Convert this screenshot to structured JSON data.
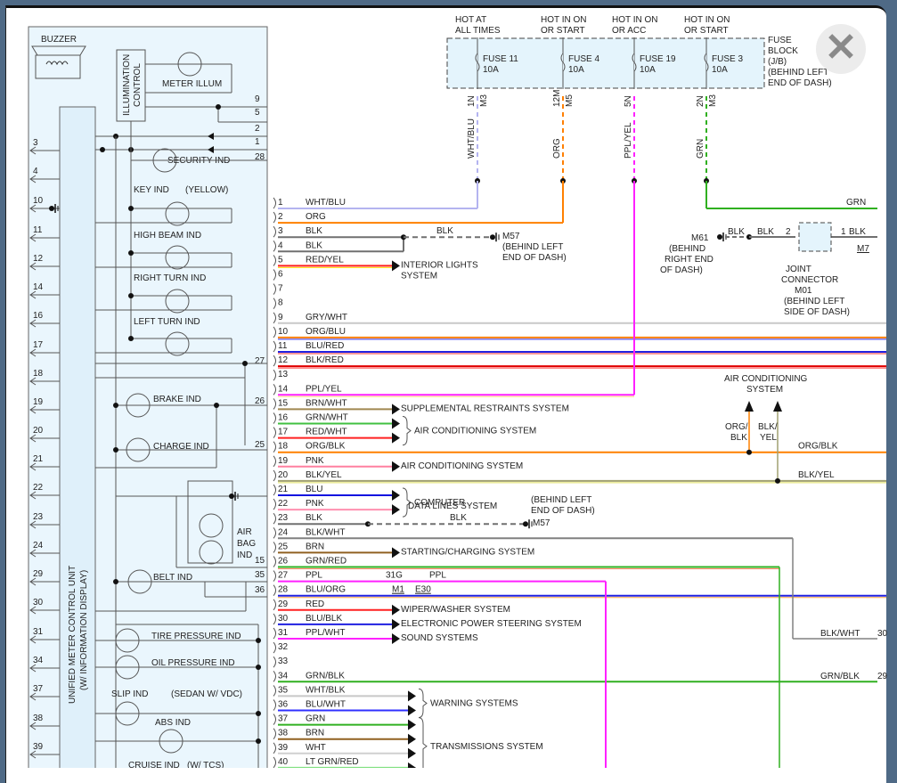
{
  "fuse_block": {
    "label": [
      "FUSE",
      "BLOCK",
      "(J/B)",
      "(BEHIND LEFT",
      "END OF DASH)"
    ],
    "fuses": [
      {
        "header": [
          "HOT AT",
          "ALL TIMES"
        ],
        "name": "FUSE 11",
        "rating": "10A",
        "terminal": "1N",
        "connector": "M3",
        "wire": "WHT/BLU",
        "color": "#b4b4f0"
      },
      {
        "header": [
          "HOT IN ON",
          "OR START"
        ],
        "name": "FUSE 4",
        "rating": "10A",
        "terminal": "12M",
        "connector": "M5",
        "wire": "ORG",
        "color": "#ff8000"
      },
      {
        "header": [
          "HOT IN ON",
          "OR ACC"
        ],
        "name": "FUSE 19",
        "rating": "10A",
        "terminal": "5N",
        "connector": "",
        "wire": "PPL/YEL",
        "color": "#ff20ff"
      },
      {
        "header": [
          "HOT IN ON",
          "OR START"
        ],
        "name": "FUSE 3",
        "rating": "10A",
        "terminal": "2N",
        "connector": "M3",
        "wire": "GRN",
        "color": "#30b020"
      }
    ]
  },
  "unit": {
    "title": [
      "UNIFIED METER CONTROL UNIT",
      "(W/ INFORMATION DISPLAY)"
    ],
    "buzzer": "BUZZER",
    "illumination": [
      "ILLUMINATION",
      "CONTROL"
    ],
    "meter_illum": "METER ILLUM",
    "left_pins": [
      "3",
      "4",
      "10",
      "11",
      "12",
      "14",
      "16",
      "17",
      "18",
      "19",
      "20",
      "21",
      "22",
      "23",
      "24",
      "29",
      "30",
      "31",
      "34",
      "37",
      "38",
      "39"
    ],
    "right_pins": {
      "p9": "9",
      "p5": "5",
      "p2": "2",
      "p1": "1",
      "p28": "28",
      "p27": "27",
      "p26": "26",
      "p25": "25",
      "p15": "15",
      "p35": "35",
      "p36": "36"
    },
    "indicators": {
      "security": "SECURITY IND",
      "key": "KEY IND",
      "yellow": "(YELLOW)",
      "high_beam": "HIGH BEAM IND",
      "right_turn": "RIGHT TURN IND",
      "left_turn": "LEFT TURN IND",
      "brake": "BRAKE IND",
      "charge": "CHARGE IND",
      "airbag": [
        "AIR",
        "BAG",
        "IND"
      ],
      "belt": "BELT IND",
      "tire": "TIRE PRESSURE IND",
      "oil": "OIL PRESSURE IND",
      "slip": "SLIP IND",
      "sedan": "(SEDAN W/ VDC)",
      "abs": "ABS IND",
      "cruise": "CRUISE IND",
      "tcs": "(W/ TCS)"
    }
  },
  "wires": [
    {
      "pin": "1",
      "name": "WHT/BLU",
      "colors": [
        "#b4b4f0"
      ]
    },
    {
      "pin": "2",
      "name": "ORG",
      "colors": [
        "#ff8000"
      ]
    },
    {
      "pin": "3",
      "name": "BLK",
      "colors": [
        "#707070"
      ]
    },
    {
      "pin": "4",
      "name": "BLK",
      "colors": [
        "#707070"
      ]
    },
    {
      "pin": "5",
      "name": "RED/YEL",
      "colors": [
        "#ff2020",
        "#ffe000"
      ],
      "dest": [
        "INTERIOR LIGHTS",
        "SYSTEM"
      ]
    },
    {
      "pin": "6",
      "name": ""
    },
    {
      "pin": "7",
      "name": ""
    },
    {
      "pin": "8",
      "name": ""
    },
    {
      "pin": "9",
      "name": "GRY/WHT",
      "colors": [
        "#c8c8c8"
      ]
    },
    {
      "pin": "10",
      "name": "ORG/BLU",
      "colors": [
        "#ff8000",
        "#3030ff"
      ]
    },
    {
      "pin": "11",
      "name": "BLU/RED",
      "colors": [
        "#2020e0",
        "#ff3030"
      ]
    },
    {
      "pin": "12",
      "name": "BLK/RED",
      "colors": [
        "#e00000",
        "#ff4040"
      ]
    },
    {
      "pin": "13",
      "name": ""
    },
    {
      "pin": "14",
      "name": "PPL/YEL",
      "colors": [
        "#ff20ff",
        "#ffe080"
      ]
    },
    {
      "pin": "15",
      "name": "BRN/WHT",
      "colors": [
        "#a08850"
      ],
      "dest": [
        "SUPPLEMENTAL RESTRAINTS SYSTEM"
      ]
    },
    {
      "pin": "16",
      "name": "GRN/WHT",
      "colors": [
        "#40c040"
      ]
    },
    {
      "pin": "17",
      "name": "RED/WHT",
      "colors": [
        "#ff2020"
      ]
    },
    {
      "pin": "18",
      "name": "ORG/BLK",
      "colors": [
        "#ff8000"
      ]
    },
    {
      "pin": "19",
      "name": "PNK",
      "colors": [
        "#ff80a0"
      ],
      "dest": [
        "AIR CONDITIONING SYSTEM"
      ]
    },
    {
      "pin": "20",
      "name": "BLK/YEL",
      "colors": [
        "#a0a070",
        "#e0e060"
      ]
    },
    {
      "pin": "21",
      "name": "BLU",
      "colors": [
        "#1010e0"
      ]
    },
    {
      "pin": "22",
      "name": "PNK",
      "colors": [
        "#ff90b0"
      ]
    },
    {
      "pin": "23",
      "name": "BLK",
      "colors": [
        "#707070"
      ]
    },
    {
      "pin": "24",
      "name": "BLK/WHT",
      "colors": [
        "#808080"
      ]
    },
    {
      "pin": "25",
      "name": "BRN",
      "colors": [
        "#906020"
      ],
      "dest": [
        "STARTING/CHARGING SYSTEM"
      ]
    },
    {
      "pin": "26",
      "name": "GRN/RED",
      "colors": [
        "#30b020",
        "#ff8060"
      ]
    },
    {
      "pin": "27",
      "name": "PPL",
      "colors": [
        "#ff20ff"
      ]
    },
    {
      "pin": "28",
      "name": "BLU/ORG",
      "colors": [
        "#2020e0",
        "#ffa040"
      ]
    },
    {
      "pin": "29",
      "name": "RED",
      "colors": [
        "#ff2020"
      ],
      "dest": [
        "WIPER/WASHER SYSTEM"
      ]
    },
    {
      "pin": "30",
      "name": "BLU/BLK",
      "colors": [
        "#2020e0"
      ],
      "dest": [
        "ELECTRONIC POWER STEERING SYSTEM"
      ]
    },
    {
      "pin": "31",
      "name": "PPL/WHT",
      "colors": [
        "#ff20ff"
      ],
      "dest": [
        "SOUND SYSTEMS"
      ]
    },
    {
      "pin": "32",
      "name": ""
    },
    {
      "pin": "33",
      "name": ""
    },
    {
      "pin": "34",
      "name": "GRN/BLK",
      "colors": [
        "#30b020"
      ]
    },
    {
      "pin": "35",
      "name": "WHT/BLK",
      "colors": [
        "#c8c8c8"
      ]
    },
    {
      "pin": "36",
      "name": "BLU/WHT",
      "colors": [
        "#3030ff"
      ]
    },
    {
      "pin": "37",
      "name": "GRN",
      "colors": [
        "#30b020"
      ]
    },
    {
      "pin": "38",
      "name": "BRN",
      "colors": [
        "#906020"
      ]
    },
    {
      "pin": "39",
      "name": "WHT",
      "colors": [
        "#d0d0d0"
      ]
    },
    {
      "pin": "40",
      "name": "LT GRN/RED",
      "colors": [
        "#80e080"
      ]
    }
  ],
  "groups": {
    "ac_16_17": "AIR CONDITIONING SYSTEM",
    "data_lines": [
      "COMPUTER",
      "DATA LINES SYSTEM"
    ],
    "warning": "WARNING SYSTEMS",
    "transmission": "TRANSMISSIONS SYSTEM"
  },
  "grounds": {
    "m57_top": {
      "wire": "BLK",
      "name": "M57",
      "loc": [
        "(BEHIND LEFT",
        "END OF DASH)"
      ]
    },
    "m57_low": {
      "wire": "BLK",
      "name": "M57",
      "loc": [
        "(BEHIND LEFT",
        "END OF DASH)"
      ]
    },
    "m61": {
      "name": "M61",
      "loc": [
        "(BEHIND",
        "RIGHT END",
        "OF DASH)"
      ],
      "wire1": "BLK",
      "wire2": "BLK"
    }
  },
  "joint_connector": {
    "label": [
      "JOINT",
      "CONNECTOR",
      "M01",
      "(BEHIND LEFT",
      "SIDE OF DASH)"
    ],
    "pin_in": "2",
    "pin_out": "1",
    "wire_out": "BLK",
    "connector": "M7"
  },
  "right_side": {
    "grn": "GRN",
    "ac_system": [
      "AIR CONDITIONING",
      "SYSTEM"
    ],
    "org_blk_up": [
      "ORG/",
      "BLK"
    ],
    "blk_yel_up": [
      "BLK/",
      "YEL"
    ],
    "org_blk": "ORG/BLK",
    "blk_yel": "BLK/YEL",
    "blk_wht": "BLK/WHT",
    "blk_wht_pin": "30",
    "grn_blk": "GRN/BLK",
    "grn_blk_pin": "29",
    "c31g": "31G",
    "ppl": "PPL",
    "m1": "M1",
    "e30": "E30"
  },
  "close_icon": "close-icon"
}
